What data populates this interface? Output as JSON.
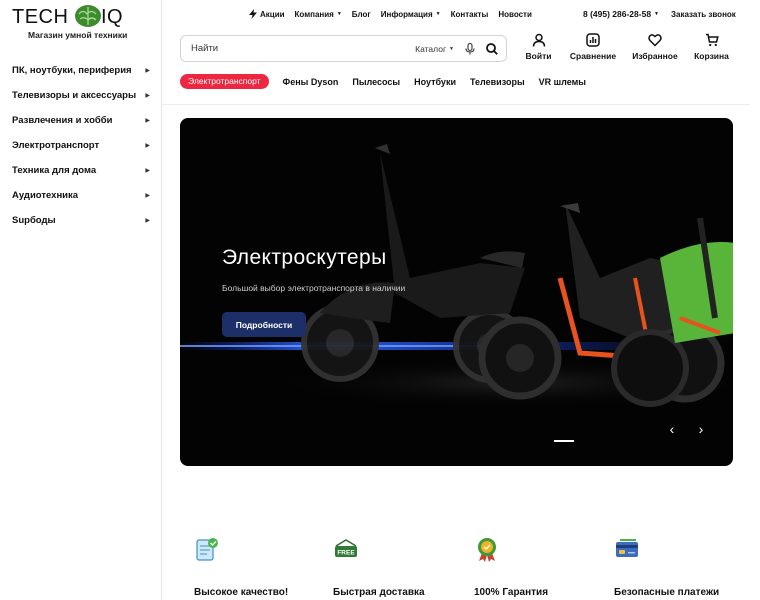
{
  "logo": {
    "left": "TECH",
    "right": "IQ",
    "tagline": "Магазин умной техники"
  },
  "categories": [
    "ПК, ноутбуки, периферия",
    "Телевизоры и аксессуары",
    "Развлечения и хобби",
    "Электротранспорт",
    "Техника для дома",
    "Аудиотехника",
    "Supбоды"
  ],
  "topnav": {
    "promo": "Акции",
    "company": "Компания",
    "blog": "Блог",
    "info": "Информация",
    "contacts": "Контакты",
    "news": "Новости",
    "phone": "8 (495) 286-28-58",
    "callback": "Заказать звонок"
  },
  "search": {
    "placeholder": "Найти",
    "catalog": "Каталог"
  },
  "actions": {
    "login": "Войти",
    "compare": "Сравнение",
    "favorites": "Избранное",
    "cart": "Корзина"
  },
  "subnav": {
    "active": "Электротранспорт",
    "links": [
      "Фены Dyson",
      "Пылесосы",
      "Ноутбуки",
      "Телевизоры",
      "VR шлемы"
    ]
  },
  "hero": {
    "title": "Электроскутеры",
    "subtitle": "Большой выбор электротранспорта в наличии",
    "button": "Подробности"
  },
  "features": [
    "Высокое качество!",
    "Быстрая доставка",
    "100% Гарантия",
    "Безопасные платежи"
  ],
  "colors": {
    "accent": "#ee2740",
    "button": "#1d2f68",
    "brain": "#3e8a2e"
  }
}
